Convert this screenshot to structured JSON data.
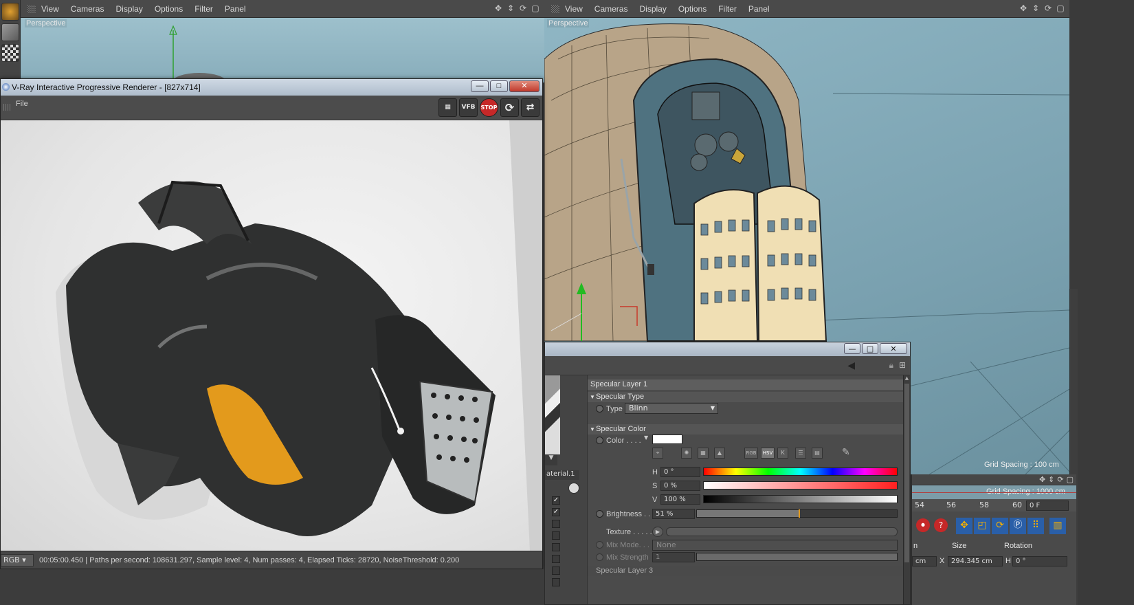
{
  "viewport_left": {
    "menu": [
      "View",
      "Cameras",
      "Display",
      "Options",
      "Filter",
      "Panel"
    ],
    "label": "Perspective"
  },
  "viewport_right": {
    "menu": [
      "View",
      "Cameras",
      "Display",
      "Options",
      "Filter",
      "Panel"
    ],
    "label": "Perspective",
    "grid_spacing": "Grid Spacing : 100 cm"
  },
  "vray": {
    "title": "V-Ray Interactive Progressive Renderer - [827x714]",
    "menu_file": "File",
    "tools": [
      "film-icon",
      "VFB",
      "STOP",
      "refresh-icon",
      "swap-icon"
    ],
    "tool_vfb": "VFB",
    "tool_stop": "STOP",
    "channel": "RGB",
    "status": "00:05:00.450 |  Paths per second: 108631.297, Sample level: 4, Num passes: 4, Elapsed Ticks: 28720, NoiseThreshold: 0.200",
    "win_buttons": {
      "min": "—",
      "max": "□",
      "close": "✕"
    },
    "accent_orange": "#e39a1c"
  },
  "material": {
    "layer_title": "Specular Layer 1",
    "spec_type_header": "Specular Type",
    "type_label": "Type",
    "type_value": "Blinn",
    "spec_color_header": "Specular Color",
    "color_label": "Color . . . .",
    "color_swatch": "#ffffff",
    "mode_buttons": [
      "RGB",
      "HSV",
      "K"
    ],
    "h_label": "H",
    "h_value": "0 °",
    "s_label": "S",
    "s_value": "0 %",
    "v_label": "V",
    "v_value": "100 %",
    "brightness_label": "Brightness . .",
    "brightness_value": "51 %",
    "brightness_fraction": 0.51,
    "texture_label": "Texture . . . . .",
    "mix_mode_label": "Mix Mode. . .",
    "mix_mode_value": "None",
    "mix_strength_label": "Mix Strength",
    "mix_strength_value": "1",
    "side_label": "aterial.1",
    "bottom_cut_label": "Specular Layer 3",
    "win_buttons": {
      "min": "—",
      "max": "□",
      "close": "✕"
    }
  },
  "lower_right": {
    "grid_spacing": "Grid Spacing : 1000 cm",
    "ruler": [
      "54",
      "56",
      "58",
      "60"
    ],
    "frame_value": "0 F",
    "size_header": "Size",
    "rotation_header": "Rotation",
    "x_label": "X",
    "size_x": "294.345 cm",
    "h_label": "H",
    "rot_h": "0 °",
    "pos_unit": "cm",
    "n_header": "n"
  }
}
